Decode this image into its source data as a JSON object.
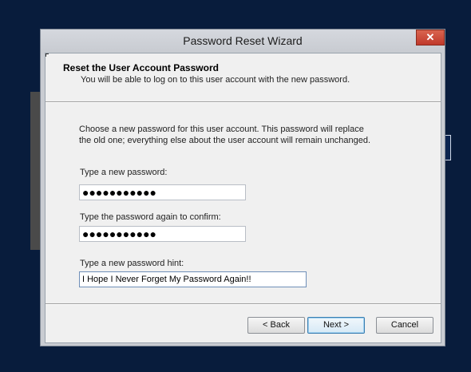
{
  "window": {
    "title": "Password Reset Wizard",
    "close_glyph": "✕"
  },
  "header": {
    "title": "Reset the User Account Password",
    "subtitle": "You will be able to log on to this user account with the new password."
  },
  "intro": {
    "line1": "Choose a new password for this user account. This password will replace",
    "line2": "the old one; everything else about the user account will remain unchanged."
  },
  "fields": {
    "new_password": {
      "label": "Type a new password:",
      "value": "●●●●●●●●●●●"
    },
    "confirm_password": {
      "label": "Type the password again to confirm:",
      "value": "●●●●●●●●●●●"
    },
    "hint": {
      "label": "Type a new password hint:",
      "value": "I Hope I Never Forget My Password Again!!"
    }
  },
  "buttons": {
    "back": "< Back",
    "next": "Next >",
    "cancel": "Cancel"
  },
  "icons": {
    "close": "close-icon"
  }
}
